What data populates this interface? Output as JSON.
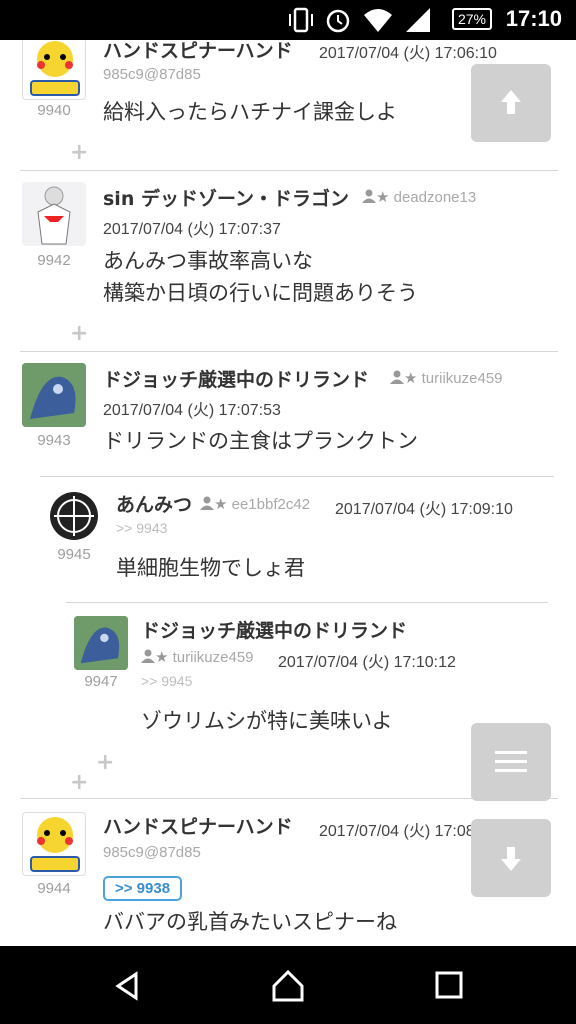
{
  "status": {
    "battery": "27%",
    "time": "17:10"
  },
  "posts": [
    {
      "num": "9940",
      "name": "ハンドスピナーハンド",
      "date": "2017/07/04 (火) 17:06:10",
      "uid": "985c9@87d85",
      "body": [
        "給料入ったらハチナイ課金しよ"
      ]
    },
    {
      "num": "9942",
      "name": "sin デッドゾーン・ドラゴン",
      "trip": "deadzone13",
      "date": "2017/07/04 (火) 17:07:37",
      "body": [
        "あんみつ事故率高いな",
        "構築か日頃の行いに問題ありそう"
      ]
    },
    {
      "num": "9943",
      "name": "ドジョッチ厳選中のドリランド",
      "trip": "turiikuze459",
      "date": "2017/07/04 (火) 17:07:53",
      "body": [
        "ドリランドの主食はプランクトン"
      ]
    },
    {
      "num": "9945",
      "name": "あんみつ",
      "trip": "ee1bbf2c42",
      "date": "2017/07/04 (火) 17:09:10",
      "reply": ">> 9943",
      "body": [
        "単細胞生物でしょ君"
      ]
    },
    {
      "num": "9947",
      "name": "ドジョッチ厳選中のドリランド",
      "trip": "turiikuze459",
      "date": "2017/07/04 (火) 17:10:12",
      "reply": ">> 9945",
      "body": [
        "ゾウリムシが特に美味いよ"
      ]
    },
    {
      "num": "9944",
      "name": "ハンドスピナーハンド",
      "date": "2017/07/04 (火) 17:08:58",
      "uid": "985c9@87d85",
      "reply_badge": ">> 9938",
      "body": [
        "ババアの乳首みたいスピナーね"
      ]
    }
  ],
  "plus_symbol": "+",
  "colors": {
    "accent": "#4aa3df",
    "button": "#d0d0d0"
  },
  "icons": [
    "vibrate-icon",
    "alarm-icon",
    "wifi-icon",
    "signal-icon",
    "battery-icon",
    "scroll-up-icon",
    "menu-icon",
    "scroll-down-icon",
    "back-icon",
    "home-icon",
    "recents-icon"
  ]
}
